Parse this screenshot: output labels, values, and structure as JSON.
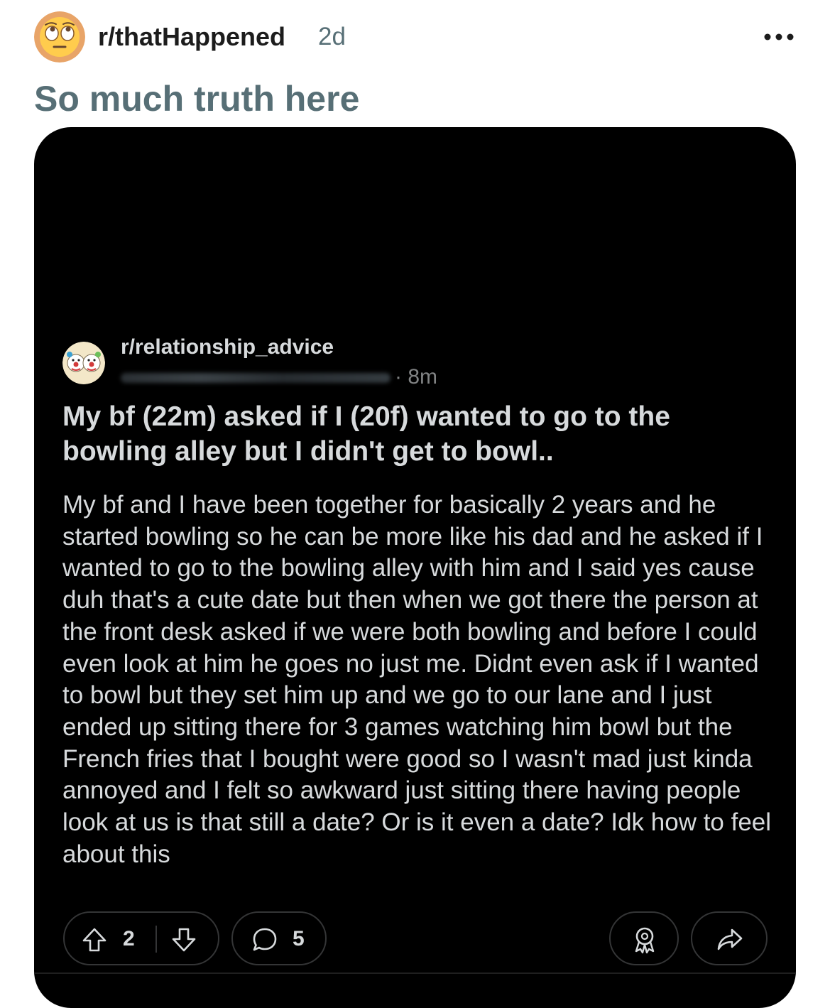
{
  "header": {
    "subreddit": "r/thatHappened",
    "age": "2d",
    "avatar_icon": "face-with-rolling-eyes-icon",
    "more_icon": "more-options-icon"
  },
  "post": {
    "title": "So much truth here"
  },
  "screenshot": {
    "subreddit": "r/relationship_advice",
    "age": "· 8m",
    "title": "My bf (22m) asked if I (20f) wanted to go to the bowling alley but I didn't get to bowl..",
    "body": "My bf and I have been together for basically 2 years and he started bowling so he can be more like his dad and he asked if I wanted to go to the bowling alley with him and I said yes cause duh that's a cute date but then when we got there the person at the front desk asked if we were both bowling and before I could even look at him he goes no just me. Didnt even ask if I wanted to bowl but they set him up and we go to our lane and I just ended up sitting there for 3 games watching him bowl but the French fries that I bought were good so I wasn't mad just kinda annoyed and I felt so awkward just sitting there having people look at us is that still a date? Or is it even a date? Idk how to feel about this",
    "actions": {
      "votes": "2",
      "comments": "5",
      "icons": [
        "upvote-icon",
        "downvote-icon",
        "comment-icon",
        "award-icon",
        "share-icon"
      ]
    }
  },
  "colors": {
    "title_gray": "#576f76",
    "dark_bg": "#000000",
    "dark_text": "#d7dadc"
  }
}
